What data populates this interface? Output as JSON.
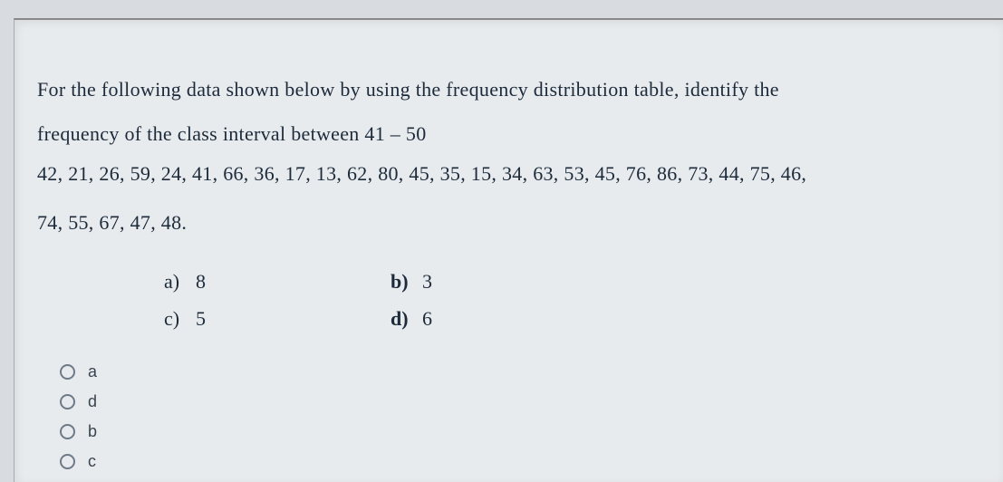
{
  "question": {
    "line1": "For the following data shown below  by using the frequency distribution table,  identify the",
    "line2": "frequency of the class interval between 41 – 50",
    "line3": "42, 21, 26, 59, 24, 41, 66, 36, 17, 13, 62, 80, 45, 35, 15, 34, 63, 53, 45, 76, 86, 73, 44, 75, 46,",
    "line4": "74, 55, 67, 47, 48."
  },
  "answers": {
    "a": {
      "label": "a)",
      "value": "8"
    },
    "b": {
      "label": "b)",
      "value": "3"
    },
    "c": {
      "label": "c)",
      "value": "5"
    },
    "d": {
      "label": "d)",
      "value": "6"
    }
  },
  "options": [
    {
      "letter": "a"
    },
    {
      "letter": "d"
    },
    {
      "letter": "b"
    },
    {
      "letter": "c"
    }
  ]
}
